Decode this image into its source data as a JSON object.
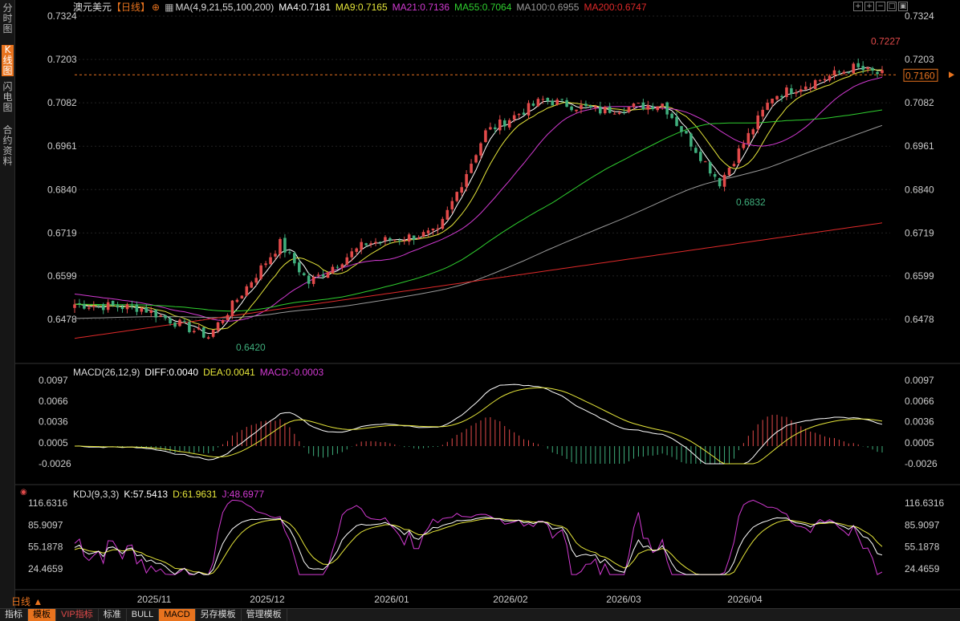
{
  "sidebar": {
    "tabs": [
      {
        "label": "分时图",
        "active": false
      },
      {
        "label": "K线图",
        "active": true
      },
      {
        "label": "闪电图",
        "active": false
      },
      {
        "label": "合约资料",
        "active": false
      }
    ]
  },
  "header": {
    "symbol": "澳元美元",
    "period_tag": "【日线】",
    "ma_label": "MA(4,9,21,55,100,200)",
    "ma4": "MA4:0.7181",
    "ma9": "MA9:0.7165",
    "ma21": "MA21:0.7136",
    "ma55": "MA55:0.7064",
    "ma100": "MA100:0.6955",
    "ma200": "MA200:0.6747"
  },
  "macd_header": {
    "label": "MACD(26,12,9)",
    "diff": "DIFF:0.0040",
    "dea": "DEA:0.0041",
    "macd": "MACD:-0.0003"
  },
  "kdj_header": {
    "label": "KDJ(9,3,3)",
    "k": "K:57.5413",
    "d": "D:61.9631",
    "j": "J:48.6977"
  },
  "price_axis": [
    "0.7324",
    "0.7203",
    "0.7082",
    "0.6961",
    "0.6840",
    "0.6719",
    "0.6599",
    "0.6478"
  ],
  "macd_axis": [
    "0.0097",
    "0.0066",
    "0.0036",
    "0.0005",
    "-0.0026"
  ],
  "kdj_axis": [
    "116.6316",
    "85.9097",
    "55.1878",
    "24.4659"
  ],
  "date_labels": [
    "2025/11",
    "2025/12",
    "2026/01",
    "2026/02",
    "2026/03",
    "2026/04"
  ],
  "annotations": {
    "high": "0.7227",
    "mid_low": "0.6832",
    "low": "0.6420",
    "current": "0.7160"
  },
  "period_selector": "日线",
  "bottom_tabs": [
    {
      "label": "指标",
      "active": false
    },
    {
      "label": "模板",
      "active": true
    },
    {
      "label": "VIP指标",
      "active": false,
      "red": true
    },
    {
      "label": "标准",
      "active": false
    },
    {
      "label": "BULL",
      "active": false
    },
    {
      "label": "MACD",
      "active": true
    },
    {
      "label": "另存模板",
      "active": false
    },
    {
      "label": "管理模板",
      "active": false
    }
  ],
  "colors": {
    "up": "#e24a4a",
    "down": "#3fae7c",
    "ma4": "#ffffff",
    "ma9": "#e6e63a",
    "ma21": "#d23ad2",
    "ma55": "#2fcf2f",
    "ma100": "#9a9a9a",
    "ma200": "#e02a2a",
    "accent": "#e8731e"
  },
  "chart_data": {
    "type": "candlestick",
    "price_keypoints": [
      {
        "date": "2025-10-22",
        "price": 0.652
      },
      {
        "date": "2025-11-08",
        "price": 0.651
      },
      {
        "date": "2025-11-24",
        "price": 0.643
      },
      {
        "date": "2025-12-12",
        "price": 0.669
      },
      {
        "date": "2025-12-19",
        "price": 0.658
      },
      {
        "date": "2026-01-02",
        "price": 0.669
      },
      {
        "date": "2026-01-20",
        "price": 0.672
      },
      {
        "date": "2026-02-01",
        "price": 0.7
      },
      {
        "date": "2026-02-15",
        "price": 0.709
      },
      {
        "date": "2026-03-01",
        "price": 0.706
      },
      {
        "date": "2026-03-17",
        "price": 0.708
      },
      {
        "date": "2026-03-31",
        "price": 0.686
      },
      {
        "date": "2026-04-13",
        "price": 0.71
      },
      {
        "date": "2026-05-03",
        "price": 0.718
      },
      {
        "date": "2026-05-10",
        "price": 0.716
      }
    ],
    "ylim": [
      0.642,
      0.7324
    ]
  }
}
